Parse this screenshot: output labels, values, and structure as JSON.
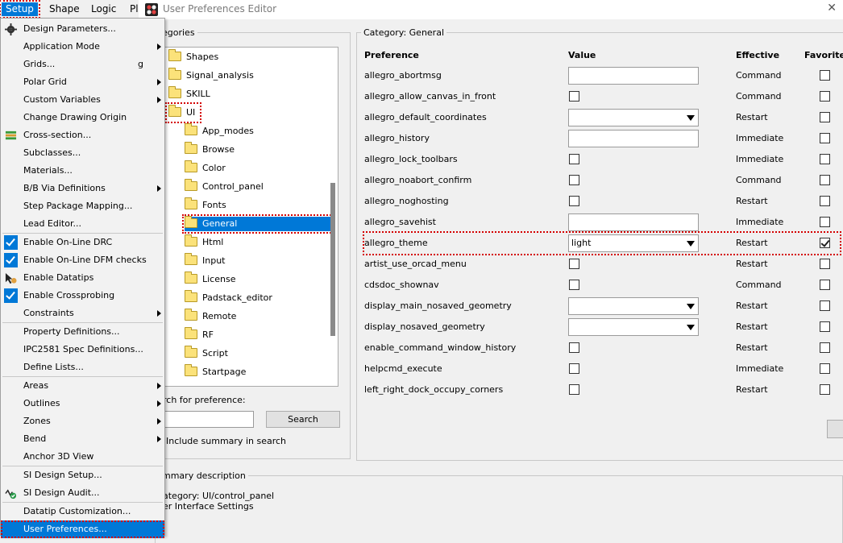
{
  "menubar": {
    "items": [
      {
        "label": "Setup",
        "active": true
      },
      {
        "label": "Shape"
      },
      {
        "label": "Logic"
      },
      {
        "label": "Pl"
      }
    ]
  },
  "dialog": {
    "title": "User Preferences Editor",
    "categories_legend": "egories",
    "tree": [
      {
        "label": "Shapes",
        "level": 0
      },
      {
        "label": "Signal_analysis",
        "level": 0
      },
      {
        "label": "SKILL",
        "level": 0
      },
      {
        "label": "UI",
        "level": 0,
        "marked": true
      },
      {
        "label": "App_modes",
        "level": 1
      },
      {
        "label": "Browse",
        "level": 1
      },
      {
        "label": "Color",
        "level": 1
      },
      {
        "label": "Control_panel",
        "level": 1
      },
      {
        "label": "Fonts",
        "level": 1
      },
      {
        "label": "General",
        "level": 1,
        "selected": true
      },
      {
        "label": "Html",
        "level": 1
      },
      {
        "label": "Input",
        "level": 1
      },
      {
        "label": "License",
        "level": 1
      },
      {
        "label": "Padstack_editor",
        "level": 1
      },
      {
        "label": "Remote",
        "level": 1
      },
      {
        "label": "RF",
        "level": 1
      },
      {
        "label": "Script",
        "level": 1
      },
      {
        "label": "Startpage",
        "level": 1
      }
    ],
    "search_label": "rch for preference:",
    "search_value": "",
    "search_button": "Search",
    "include_summary": "Include summary in search",
    "summary_legend": "mmary description",
    "summary_line1": "ategory: UI/control_panel",
    "summary_line2": "er Interface Settings",
    "category_legend": "Category:  General",
    "columns": {
      "preference": "Preference",
      "value": "Value",
      "effective": "Effective",
      "favorite": "Favorite"
    },
    "prefs": [
      {
        "name": "allegro_abortmsg",
        "type": "text",
        "value": "",
        "effective": "Command",
        "favorite": false
      },
      {
        "name": "allegro_allow_canvas_in_front",
        "type": "check",
        "checked": false,
        "effective": "Command",
        "favorite": false
      },
      {
        "name": "allegro_default_coordinates",
        "type": "combo",
        "value": "",
        "effective": "Restart",
        "favorite": false
      },
      {
        "name": "allegro_history",
        "type": "text",
        "value": "",
        "effective": "Immediate",
        "favorite": false
      },
      {
        "name": "allegro_lock_toolbars",
        "type": "check",
        "checked": false,
        "effective": "Immediate",
        "favorite": false
      },
      {
        "name": "allegro_noabort_confirm",
        "type": "check",
        "checked": false,
        "effective": "Command",
        "favorite": false
      },
      {
        "name": "allegro_noghosting",
        "type": "check",
        "checked": false,
        "effective": "Restart",
        "favorite": false
      },
      {
        "name": "allegro_savehist",
        "type": "text",
        "value": "",
        "effective": "Immediate",
        "favorite": false
      },
      {
        "name": "allegro_theme",
        "type": "combo",
        "value": "light",
        "effective": "Restart",
        "favorite": true,
        "marked": true
      },
      {
        "name": "artist_use_orcad_menu",
        "type": "check",
        "checked": false,
        "effective": "Restart",
        "favorite": false
      },
      {
        "name": "cdsdoc_shownav",
        "type": "check",
        "checked": false,
        "effective": "Command",
        "favorite": false
      },
      {
        "name": "display_main_nosaved_geometry",
        "type": "combo",
        "value": "",
        "effective": "Restart",
        "favorite": false
      },
      {
        "name": "display_nosaved_geometry",
        "type": "combo",
        "value": "",
        "effective": "Restart",
        "favorite": false
      },
      {
        "name": "enable_command_window_history",
        "type": "check",
        "checked": false,
        "effective": "Restart",
        "favorite": false
      },
      {
        "name": "helpcmd_execute",
        "type": "check",
        "checked": false,
        "effective": "Immediate",
        "favorite": false
      },
      {
        "name": "left_right_dock_occupy_corners",
        "type": "check",
        "checked": false,
        "effective": "Restart",
        "favorite": false
      }
    ]
  },
  "setup_menu": {
    "items": [
      {
        "label": "Design Parameters...",
        "icon": "gear-icon"
      },
      {
        "label": "Application Mode",
        "submenu": true
      },
      {
        "label": "Grids...",
        "shortcut": "g"
      },
      {
        "label": "Polar Grid",
        "submenu": true
      },
      {
        "label": "Custom Variables",
        "submenu": true
      },
      {
        "label": "Change Drawing Origin"
      },
      {
        "label": "Cross-section...",
        "icon": "layers-icon"
      },
      {
        "label": "Subclasses..."
      },
      {
        "label": "Materials..."
      },
      {
        "label": "B/B Via Definitions",
        "submenu": true
      },
      {
        "label": "Step Package Mapping..."
      },
      {
        "label": "Lead Editor..."
      },
      {
        "sep": true
      },
      {
        "label": "Enable On-Line DRC",
        "checked": true
      },
      {
        "label": "Enable On-Line DFM checks",
        "checked": true
      },
      {
        "label": "Enable Datatips",
        "icon": "datatip-icon"
      },
      {
        "label": "Enable Crossprobing",
        "checked": true
      },
      {
        "label": "Constraints",
        "submenu": true
      },
      {
        "sep": true
      },
      {
        "label": "Property Definitions..."
      },
      {
        "label": "IPC2581 Spec Definitions..."
      },
      {
        "label": "Define Lists..."
      },
      {
        "sep": true
      },
      {
        "label": "Areas",
        "submenu": true
      },
      {
        "label": "Outlines",
        "submenu": true
      },
      {
        "label": "Zones",
        "submenu": true
      },
      {
        "label": "Bend",
        "submenu": true
      },
      {
        "label": "Anchor 3D View"
      },
      {
        "sep": true
      },
      {
        "label": "SI Design Setup..."
      },
      {
        "label": "SI Design Audit...",
        "icon": "audit-icon"
      },
      {
        "sep": true
      },
      {
        "label": "Datatip Customization..."
      },
      {
        "label": "User Preferences...",
        "highlighted": true
      }
    ]
  },
  "colors": {
    "accent": "#0078d7",
    "annotation": "#d40000"
  }
}
